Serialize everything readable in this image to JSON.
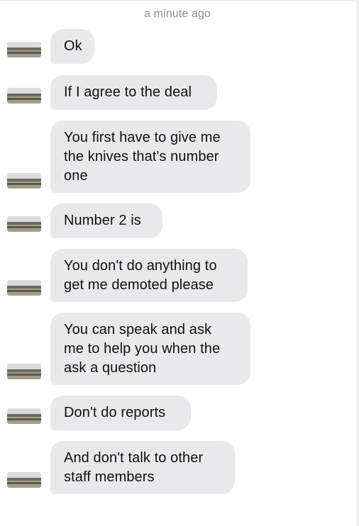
{
  "thread": {
    "timestamp": "a minute ago",
    "messages": [
      {
        "text": "Ok"
      },
      {
        "text": "If I agree to the deal"
      },
      {
        "text": "You first have to give me\nthe knives that's number\none"
      },
      {
        "text": "Number 2 is"
      },
      {
        "text": "You don't do anything to\nget me demoted please"
      },
      {
        "text": "You can speak and ask\nme to help you when the\nask a question"
      },
      {
        "text": "Don't do reports"
      },
      {
        "text": "And don't talk to other\nstaff members"
      }
    ]
  },
  "avatar_icon": "landscape-photo-avatar-icon"
}
